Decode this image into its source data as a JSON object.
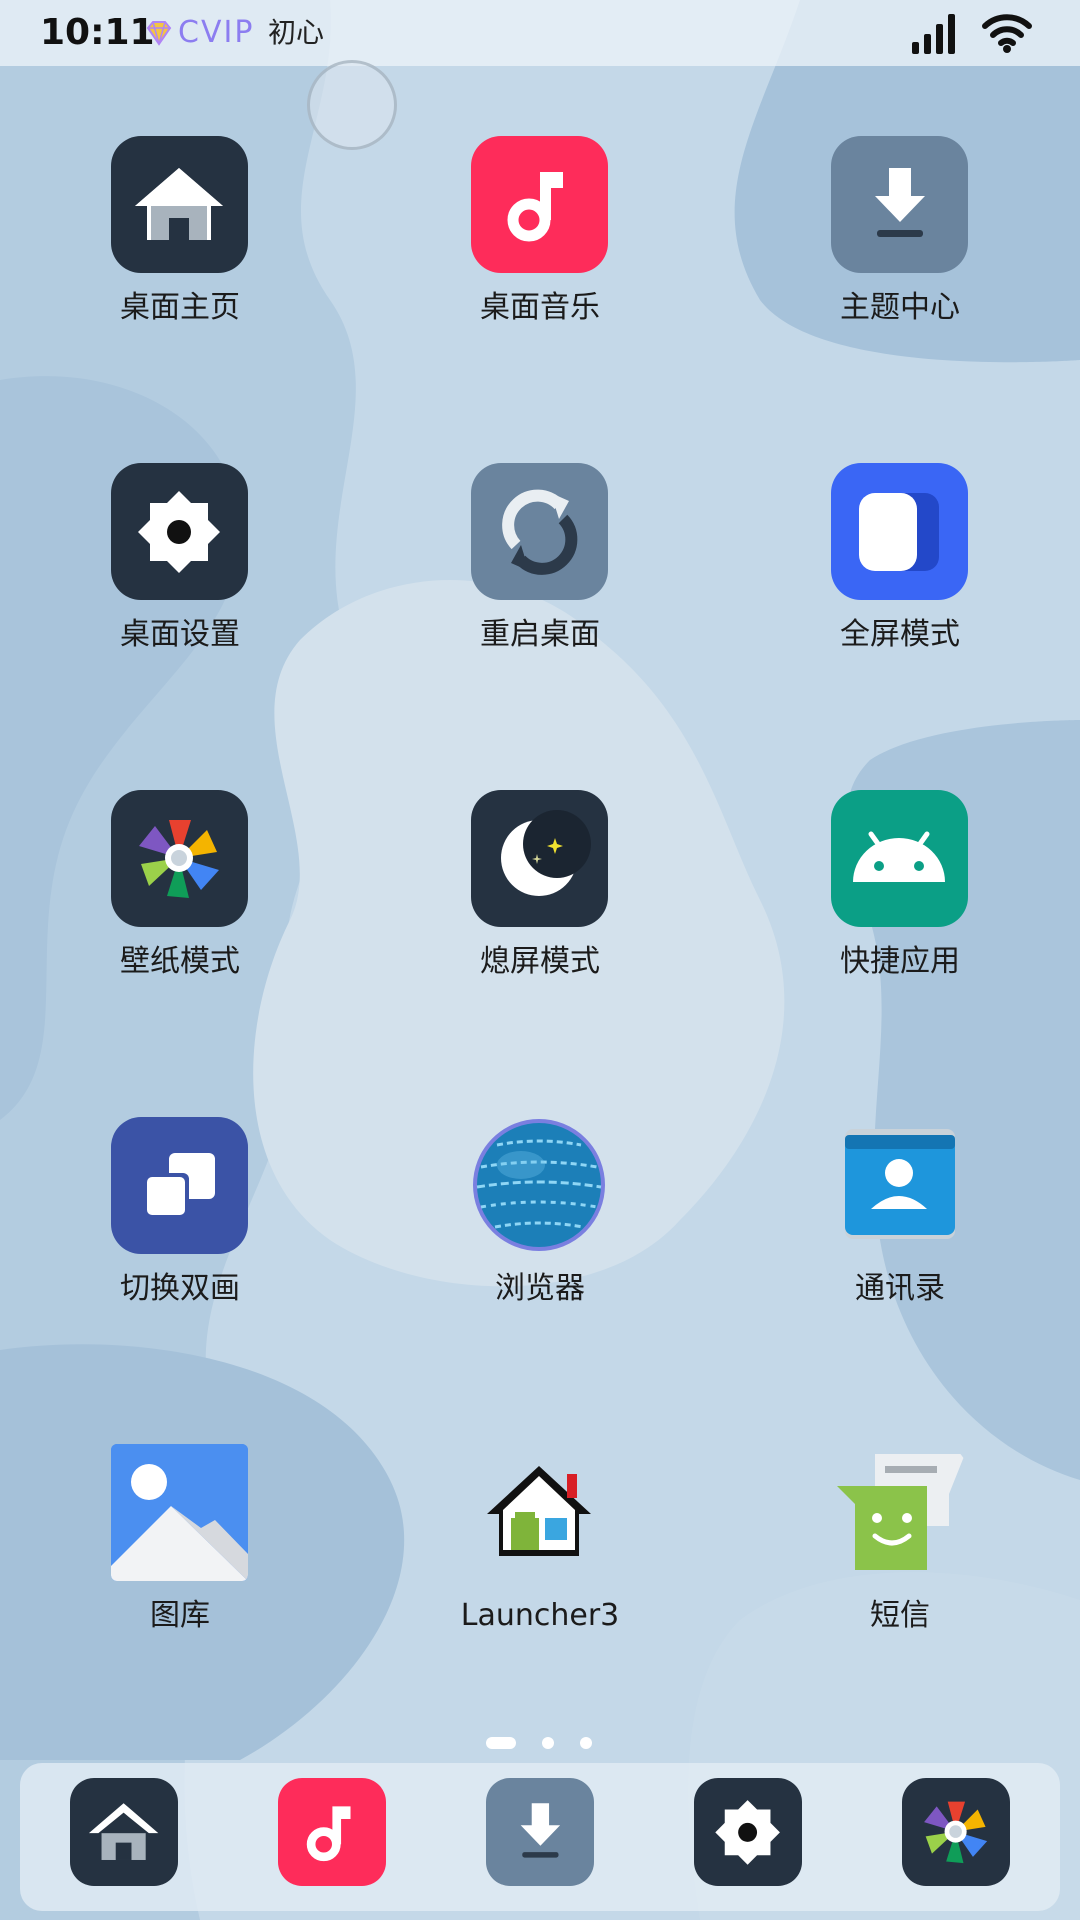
{
  "status_bar": {
    "time": "10:11",
    "vip_badge": "CVIP",
    "vip_name": "初心",
    "icons": [
      "diamond-icon",
      "signal-icon",
      "wifi-icon"
    ]
  },
  "apps": [
    {
      "label": "桌面主页",
      "icon": "home-icon",
      "bg": "#253241"
    },
    {
      "label": "桌面音乐",
      "icon": "music-note-icon",
      "bg": "#fe2c5a"
    },
    {
      "label": "主题中心",
      "icon": "download-icon",
      "bg": "#6a849e"
    },
    {
      "label": "桌面设置",
      "icon": "gear-icon",
      "bg": "#253241"
    },
    {
      "label": "重启桌面",
      "icon": "refresh-icon",
      "bg": "#6a849e"
    },
    {
      "label": "全屏模式",
      "icon": "fullscreen-icon",
      "bg": "#3a66f5"
    },
    {
      "label": "壁纸模式",
      "icon": "pinwheel-icon",
      "bg": "#253241"
    },
    {
      "label": "熄屏模式",
      "icon": "moon-icon",
      "bg": "#253241"
    },
    {
      "label": "快捷应用",
      "icon": "android-icon",
      "bg": "#0b9f86"
    },
    {
      "label": "切换双画",
      "icon": "dual-screen-icon",
      "bg": "#3b53a6"
    },
    {
      "label": "浏览器",
      "icon": "globe-icon",
      "bg": "transparent"
    },
    {
      "label": "通讯录",
      "icon": "contacts-icon",
      "bg": "transparent"
    },
    {
      "label": "图库",
      "icon": "gallery-icon",
      "bg": "#4b8ff0"
    },
    {
      "label": "Launcher3",
      "icon": "launcher-house-icon",
      "bg": "transparent"
    },
    {
      "label": "短信",
      "icon": "messages-icon",
      "bg": "transparent"
    }
  ],
  "page_indicator": {
    "pages": 3,
    "current": 1
  },
  "dock": [
    "home-icon",
    "music-note-icon",
    "download-icon",
    "gear-icon",
    "pinwheel-icon"
  ],
  "colors": {
    "dark_tile": "#253241",
    "red_tile": "#fe2c5a",
    "grey_tile": "#6a849e",
    "blue_tile": "#3a66f5",
    "green_tile": "#0b9f86",
    "indigo_tile": "#3b53a6",
    "wallpaper": "#b7cfe2",
    "vip_accent": "#8c7df0"
  }
}
